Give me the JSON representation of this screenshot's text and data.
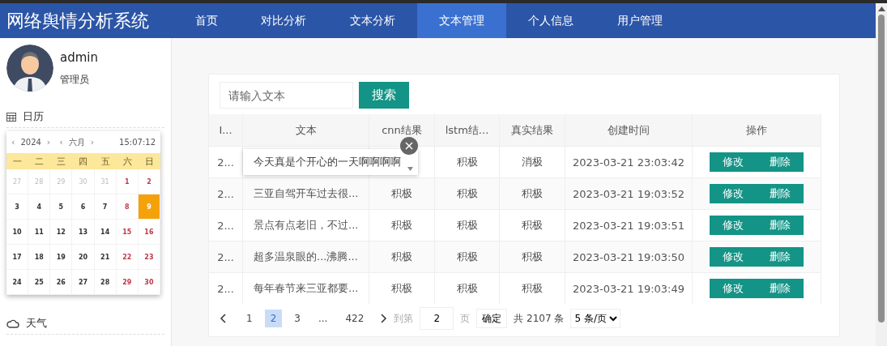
{
  "header": {
    "title": "网络舆情分析系统"
  },
  "nav": [
    {
      "label": "首页",
      "selected": false
    },
    {
      "label": "对比分析",
      "selected": false
    },
    {
      "label": "文本分析",
      "selected": false
    },
    {
      "label": "文本管理",
      "selected": true
    },
    {
      "label": "个人信息",
      "selected": false
    },
    {
      "label": "用户管理",
      "selected": false
    }
  ],
  "user": {
    "name": "admin",
    "role": "管理员"
  },
  "calendar": {
    "title": "日历",
    "year_prev": "‹",
    "year": "2024",
    "year_next": "›",
    "month_prev": "‹",
    "month": "六月",
    "month_next": "›",
    "time": "15:07:12",
    "weekdays": [
      "一",
      "二",
      "三",
      "四",
      "五",
      "六",
      "日"
    ],
    "weeks": [
      [
        {
          "day": "27",
          "kind": "other",
          "selected": false
        },
        {
          "day": "28",
          "kind": "other",
          "selected": false
        },
        {
          "day": "29",
          "kind": "other",
          "selected": false
        },
        {
          "day": "30",
          "kind": "other",
          "selected": false
        },
        {
          "day": "31",
          "kind": "other",
          "selected": false
        },
        {
          "day": "1",
          "kind": "weekend",
          "selected": false
        },
        {
          "day": "2",
          "kind": "weekend",
          "selected": false
        }
      ],
      [
        {
          "day": "3",
          "kind": "weekday",
          "selected": false
        },
        {
          "day": "4",
          "kind": "weekday",
          "selected": false
        },
        {
          "day": "5",
          "kind": "weekday",
          "selected": false
        },
        {
          "day": "6",
          "kind": "weekday",
          "selected": false
        },
        {
          "day": "7",
          "kind": "weekday",
          "selected": false
        },
        {
          "day": "8",
          "kind": "weekend",
          "selected": false
        },
        {
          "day": "9",
          "kind": "weekend",
          "selected": true
        }
      ],
      [
        {
          "day": "10",
          "kind": "weekday",
          "selected": false
        },
        {
          "day": "11",
          "kind": "weekday",
          "selected": false
        },
        {
          "day": "12",
          "kind": "weekday",
          "selected": false
        },
        {
          "day": "13",
          "kind": "weekday",
          "selected": false
        },
        {
          "day": "14",
          "kind": "weekday",
          "selected": false
        },
        {
          "day": "15",
          "kind": "weekend",
          "selected": false
        },
        {
          "day": "16",
          "kind": "weekend",
          "selected": false
        }
      ],
      [
        {
          "day": "17",
          "kind": "weekday",
          "selected": false
        },
        {
          "day": "18",
          "kind": "weekday",
          "selected": false
        },
        {
          "day": "19",
          "kind": "weekday",
          "selected": false
        },
        {
          "day": "20",
          "kind": "weekday",
          "selected": false
        },
        {
          "day": "21",
          "kind": "weekday",
          "selected": false
        },
        {
          "day": "22",
          "kind": "weekend",
          "selected": false
        },
        {
          "day": "23",
          "kind": "weekend",
          "selected": false
        }
      ],
      [
        {
          "day": "24",
          "kind": "weekday",
          "selected": false
        },
        {
          "day": "25",
          "kind": "weekday",
          "selected": false
        },
        {
          "day": "26",
          "kind": "weekday",
          "selected": false
        },
        {
          "day": "27",
          "kind": "weekday",
          "selected": false
        },
        {
          "day": "28",
          "kind": "weekday",
          "selected": false
        },
        {
          "day": "29",
          "kind": "weekend",
          "selected": false
        },
        {
          "day": "30",
          "kind": "weekend",
          "selected": false
        }
      ]
    ]
  },
  "weather": {
    "title": "天气"
  },
  "search": {
    "placeholder": "请输入文本",
    "button": "搜索"
  },
  "table": {
    "columns": [
      "I...",
      "文本",
      "cnn结果",
      "lstm结...",
      "真实结果",
      "创建时间",
      "操作"
    ],
    "rows": [
      {
        "id": "2...",
        "text": "今天真是个开心的一天啊啊啊啊",
        "expanded": true,
        "lstm": "积极",
        "truth": "消极",
        "created": "2023-03-21 23:03:42",
        "actions": [
          "修改",
          "删除"
        ]
      },
      {
        "id": "2...",
        "text": "三亚自驾开车过去很...",
        "expanded": false,
        "cnn": "积极",
        "lstm": "积极",
        "truth": "积极",
        "created": "2023-03-21 19:03:52",
        "actions": [
          "修改",
          "删除"
        ]
      },
      {
        "id": "2...",
        "text": "景点有点老旧，不过...",
        "expanded": false,
        "cnn": "积极",
        "lstm": "积极",
        "truth": "积极",
        "created": "2023-03-21 19:03:51",
        "actions": [
          "修改",
          "删除"
        ]
      },
      {
        "id": "2...",
        "text": "超多温泉眼的...沸腾...",
        "expanded": false,
        "cnn": "积极",
        "lstm": "积极",
        "truth": "积极",
        "created": "2023-03-21 19:03:50",
        "actions": [
          "修改",
          "删除"
        ]
      },
      {
        "id": "2...",
        "text": "每年春节来三亚都要...",
        "expanded": false,
        "cnn": "积极",
        "lstm": "积极",
        "truth": "积极",
        "created": "2023-03-21 19:03:49",
        "actions": [
          "修改",
          "删除"
        ]
      }
    ]
  },
  "pagination": {
    "pages": [
      {
        "label": "1",
        "selected": false
      },
      {
        "label": "2",
        "selected": true
      },
      {
        "label": "3",
        "selected": false
      },
      {
        "label": "...",
        "selected": false
      },
      {
        "label": "422",
        "selected": false
      }
    ],
    "goto_label": "到第",
    "goto_value": "2",
    "page_unit": "页",
    "confirm": "确定",
    "total": "共 2107 条",
    "page_size": "5 条/页"
  }
}
